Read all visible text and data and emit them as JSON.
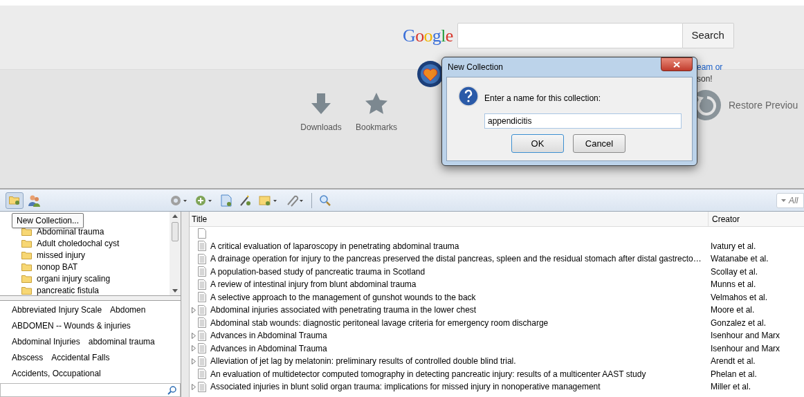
{
  "browser_home": {
    "logo": "Google",
    "search_button": "Search",
    "snippet_fragments": [
      "eam or",
      "son!"
    ],
    "shortcuts": [
      {
        "label": "Downloads",
        "kind": "download"
      },
      {
        "label": "Bookmarks",
        "kind": "star"
      }
    ],
    "restore_label": "Restore Previou"
  },
  "dialog": {
    "title": "New Collection",
    "prompt": "Enter a name for this collection:",
    "value": "appendicitis",
    "buttons": [
      "OK",
      "Cancel"
    ]
  },
  "toolbar": {
    "tooltip": "New Collection...",
    "filter_placeholder": "All"
  },
  "collections": [
    "Abdominal trauma",
    "Adult choledochal cyst",
    "missed injury",
    "nonop BAT",
    "organi injury scaling",
    "pancreatic fistula"
  ],
  "tag_rows": [
    [
      "Abbreviated Injury Scale",
      "Abdomen"
    ],
    [
      "ABDOMEN -- Wounds & injuries"
    ],
    [
      "Abdominal Injuries",
      "abdominal trauma"
    ],
    [
      "Abscess",
      "Accidental Falls"
    ],
    [
      "Accidents, Occupational"
    ]
  ],
  "table": {
    "columns": [
      "Title",
      "Creator"
    ],
    "rows": [
      {
        "title": "",
        "creator": "",
        "expander": false,
        "kind": "blank"
      },
      {
        "title": "A critical evaluation of laparoscopy in penetrating abdominal trauma",
        "creator": "Ivatury et al.",
        "expander": false,
        "kind": "document"
      },
      {
        "title": "A drainage operation for injury to the pancreas preserved the distal pancreas, spleen and the residual stomach after distal gastrecto…",
        "creator": "Watanabe et al.",
        "expander": false,
        "kind": "document"
      },
      {
        "title": "A population-based study of pancreatic trauma in Scotland",
        "creator": "Scollay et al.",
        "expander": false,
        "kind": "document"
      },
      {
        "title": "A review of intestinal injury from blunt abdominal trauma",
        "creator": "Munns et al.",
        "expander": false,
        "kind": "document"
      },
      {
        "title": "A selective approach to the management of gunshot wounds to the back",
        "creator": "Velmahos et al.",
        "expander": false,
        "kind": "document"
      },
      {
        "title": "Abdominal injuries associated with penetrating trauma in the lower chest",
        "creator": "Moore et al.",
        "expander": true,
        "kind": "document"
      },
      {
        "title": "Abdominal stab wounds: diagnostic peritoneal lavage criteria for emergency room discharge",
        "creator": "Gonzalez et al.",
        "expander": false,
        "kind": "document"
      },
      {
        "title": "Advances in Abdominal Trauma",
        "creator": "Isenhour and Marx",
        "expander": true,
        "kind": "document"
      },
      {
        "title": "Advances in Abdominal Trauma",
        "creator": "Isenhour and Marx",
        "expander": true,
        "kind": "document"
      },
      {
        "title": "Alleviation of jet lag by melatonin: preliminary results of controlled double blind trial.",
        "creator": "Arendt et al.",
        "expander": true,
        "kind": "document"
      },
      {
        "title": "An evaluation of multidetector computed tomography in detecting pancreatic injury: results of a multicenter AAST study",
        "creator": "Phelan et al.",
        "expander": false,
        "kind": "document"
      },
      {
        "title": "Associated injuries in blunt solid organ trauma: implications for missed injury in nonoperative management",
        "creator": "Miller et al.",
        "expander": true,
        "kind": "document"
      }
    ]
  }
}
